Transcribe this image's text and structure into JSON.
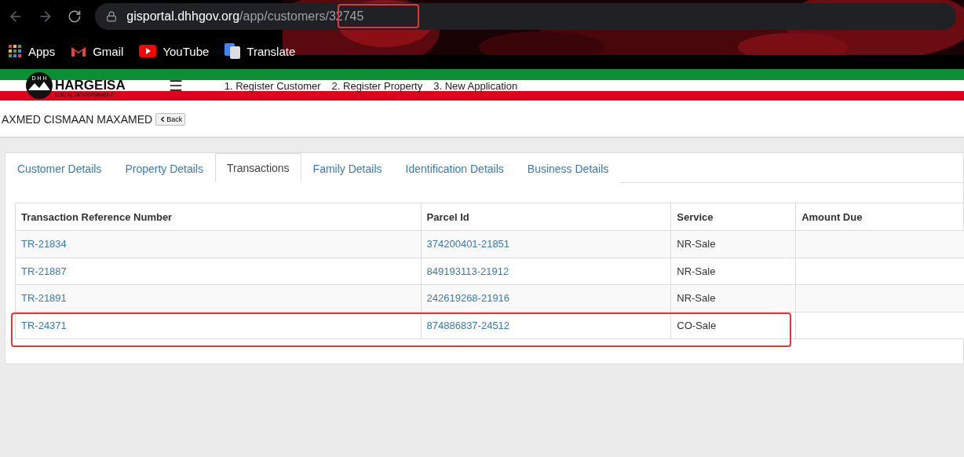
{
  "browser": {
    "url_host": "gisportal.dhhgov.org",
    "url_path": "/app/customers/32745",
    "bookmarks": [
      {
        "kind": "apps",
        "label": "Apps"
      },
      {
        "kind": "gmail",
        "label": "Gmail"
      },
      {
        "kind": "youtube",
        "label": "YouTube"
      },
      {
        "kind": "translate",
        "label": "Translate"
      }
    ]
  },
  "header": {
    "logo_letters": "D H H",
    "logo_title": "HARGEISA",
    "logo_subtitle": "LOCAL GOVERNMENT",
    "nav": [
      "1. Register Customer",
      "2. Register Property",
      "3. New Application"
    ]
  },
  "customer": {
    "name": "AXMED CISMAAN MAXAMED",
    "back_label": "Back"
  },
  "tabs": [
    {
      "label": "Customer Details",
      "selected": false
    },
    {
      "label": "Property Details",
      "selected": false
    },
    {
      "label": "Transactions",
      "selected": true
    },
    {
      "label": "Family Details",
      "selected": false
    },
    {
      "label": "Identification Details",
      "selected": false
    },
    {
      "label": "Business Details",
      "selected": false
    }
  ],
  "table": {
    "columns": [
      "Transaction Reference Number",
      "Parcel Id",
      "Service",
      "Amount Due"
    ],
    "rows": [
      {
        "reference": "TR-21834",
        "parcel": "374200401-21851",
        "service": "NR-Sale",
        "highlighted": false
      },
      {
        "reference": "TR-21887",
        "parcel": "849193113-21912",
        "service": "NR-Sale",
        "highlighted": false
      },
      {
        "reference": "TR-21891",
        "parcel": "242619268-21916",
        "service": "NR-Sale",
        "highlighted": false
      },
      {
        "reference": "TR-24371",
        "parcel": "874886837-24512",
        "service": "CO-Sale",
        "highlighted": true
      }
    ]
  },
  "url_highlight": true
}
